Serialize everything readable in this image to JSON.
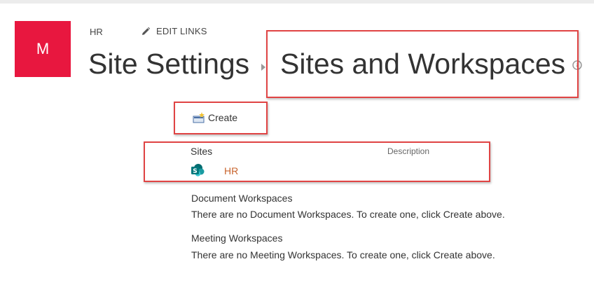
{
  "header": {
    "logo_letter": "M",
    "site_name": "HR",
    "edit_links_label": "EDIT LINKS",
    "breadcrumb_root": "Site Settings",
    "breadcrumb_current": "Sites and Workspaces"
  },
  "toolbar": {
    "create_label": "Create"
  },
  "sites": {
    "header": "Sites",
    "description_header": "Description",
    "items": [
      {
        "name": "HR"
      }
    ]
  },
  "sections": {
    "document_workspaces": {
      "title": "Document Workspaces",
      "message": "There are no Document Workspaces. To create one, click Create above."
    },
    "meeting_workspaces": {
      "title": "Meeting Workspaces",
      "message": "There are no Meeting Workspaces. To create one, click Create above."
    }
  },
  "colors": {
    "logo_bg": "#e8173f",
    "link": "#c8642d",
    "highlight": "#e04444",
    "sharepoint": "#038387"
  }
}
